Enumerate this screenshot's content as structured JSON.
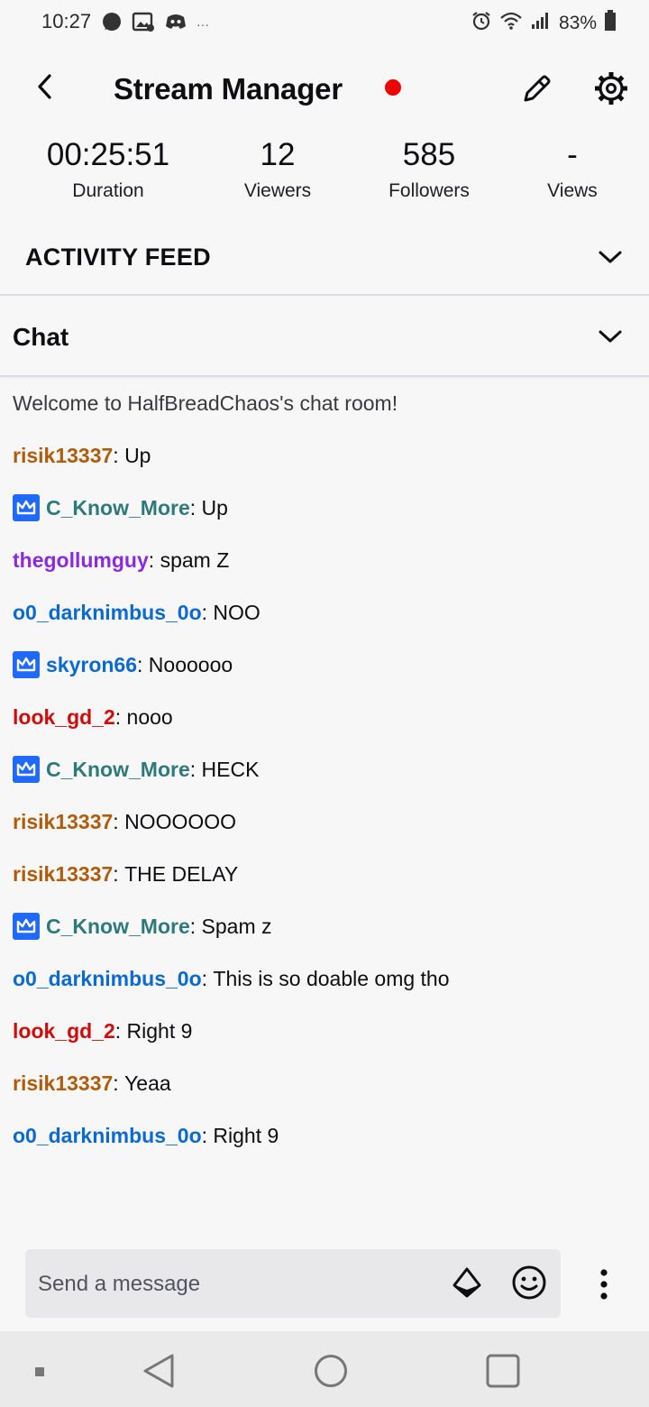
{
  "status_bar": {
    "time": "10:27",
    "battery": "83%",
    "left_icons": [
      "signal-messenger-icon",
      "image-notification-icon",
      "discord-icon",
      "more-dots-icon"
    ],
    "right_icons": [
      "alarm-icon",
      "wifi-icon",
      "cell-signal-icon",
      "battery-icon"
    ]
  },
  "header": {
    "title": "Stream Manager",
    "live_color": "#eb0400"
  },
  "stats": [
    {
      "value": "00:25:51",
      "label": "Duration"
    },
    {
      "value": "12",
      "label": "Viewers"
    },
    {
      "value": "585",
      "label": "Followers"
    },
    {
      "value": "-",
      "label": "Views"
    }
  ],
  "activity_feed": {
    "title": "ACTIVITY FEED"
  },
  "chat": {
    "title": "Chat",
    "welcome": "Welcome to HalfBreadChaos's chat room!",
    "messages": [
      {
        "user": "risik13337",
        "color": "#b15c0a",
        "badge": false,
        "text": "Up"
      },
      {
        "user": "C_Know_More",
        "color": "#2e7a7a",
        "badge": true,
        "text": "Up"
      },
      {
        "user": "thegollumguy",
        "color": "#8a2be2",
        "badge": false,
        "text": "spam Z"
      },
      {
        "user": "o0_darknimbus_0o",
        "color": "#0a6ad1",
        "badge": false,
        "text": "NOO"
      },
      {
        "user": "skyron66",
        "color": "#0a6ad1",
        "badge": true,
        "text": "Noooooo"
      },
      {
        "user": "look_gd_2",
        "color": "#d10a0a",
        "badge": false,
        "text": "nooo"
      },
      {
        "user": "C_Know_More",
        "color": "#2e7a7a",
        "badge": true,
        "text": "HECK"
      },
      {
        "user": "risik13337",
        "color": "#b15c0a",
        "badge": false,
        "text": "NOOOOOO"
      },
      {
        "user": "risik13337",
        "color": "#b15c0a",
        "badge": false,
        "text": "THE DELAY"
      },
      {
        "user": "C_Know_More",
        "color": "#2e7a7a",
        "badge": true,
        "text": "Spam z"
      },
      {
        "user": "o0_darknimbus_0o",
        "color": "#0a6ad1",
        "badge": false,
        "text": "This is so doable omg tho"
      },
      {
        "user": "look_gd_2",
        "color": "#d10a0a",
        "badge": false,
        "text": "Right 9"
      },
      {
        "user": "risik13337",
        "color": "#b15c0a",
        "badge": false,
        "text": "Yeaa"
      },
      {
        "user": "o0_darknimbus_0o",
        "color": "#0a6ad1",
        "badge": false,
        "text": "Right 9"
      }
    ]
  },
  "input": {
    "placeholder": "Send a message",
    "value": ""
  },
  "badge_color": "#1f69ff"
}
